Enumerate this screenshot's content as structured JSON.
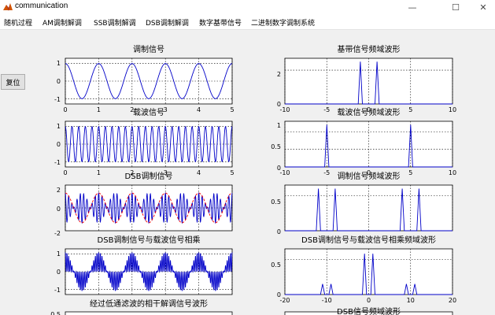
{
  "window": {
    "title": "communication",
    "minimize_glyph": "—",
    "maximize_glyph": "☐",
    "close_glyph": "✕"
  },
  "menu": [
    "随机过程",
    "AM调制解调",
    "SSB调制解调",
    "DSB调制解调",
    "数字基带信号",
    "二进制数字调制系统"
  ],
  "reset_button": "复位",
  "chart_data": [
    {
      "type": "line",
      "title": "调制信号",
      "xlim": [
        0,
        5
      ],
      "ylim": [
        -1.3,
        1.3
      ],
      "xticks": [
        "0",
        "1",
        "2",
        "3",
        "4",
        "5"
      ],
      "yticks": [
        "1",
        "0",
        "-1"
      ],
      "series": [
        {
          "function": "cos",
          "frequency": 1,
          "amplitude": 1,
          "color": "#0000c8"
        }
      ]
    },
    {
      "type": "line",
      "title": "载波信号",
      "xlim": [
        0,
        5
      ],
      "ylim": [
        -1.3,
        1.3
      ],
      "xticks": [
        "0",
        "1",
        "2",
        "3",
        "4",
        "5"
      ],
      "yticks": [
        "1",
        "0",
        "-1"
      ],
      "series": [
        {
          "function": "cos",
          "frequency": 5,
          "amplitude": 1,
          "color": "#0000c8"
        }
      ]
    },
    {
      "type": "line",
      "title": "DSB调制信号",
      "xlim": [
        0,
        5
      ],
      "ylim": [
        -2,
        2
      ],
      "xticks": [],
      "yticks": [
        "2",
        "0",
        "-2"
      ],
      "series": [
        {
          "function": "dsb",
          "color": "#0000c8"
        },
        {
          "function": "envelope",
          "amplitude": 1.3,
          "frequency": 1,
          "color": "#ff0000",
          "dashed": true
        }
      ]
    },
    {
      "type": "line",
      "title": "DSB调制信号与载波信号相乘",
      "xlim": [
        0,
        5
      ],
      "ylim": [
        -1.3,
        1.3
      ],
      "xticks": [],
      "yticks": [
        "1",
        "0",
        "-1"
      ],
      "series": [
        {
          "function": "product",
          "color": "#0000c8"
        }
      ]
    },
    {
      "type": "line",
      "title": "基带信号频域波形",
      "xlim": [
        -10,
        10
      ],
      "ylim": [
        0,
        2.7
      ],
      "xticks": [
        "-10",
        "-5",
        "0",
        "5",
        "10"
      ],
      "yticks": [
        "2",
        "0"
      ],
      "series": [
        {
          "peaks": [
            {
              "x": -1,
              "y": 2.5
            },
            {
              "x": 1,
              "y": 2.5
            }
          ],
          "color": "#0000c8"
        }
      ]
    },
    {
      "type": "line",
      "title": "载波信号频域波形",
      "xlim": [
        -10,
        10
      ],
      "ylim": [
        0,
        1.3
      ],
      "xticks": [
        "-10",
        "-5",
        "0",
        "5",
        "10"
      ],
      "yticks": [
        "1",
        "0.5",
        "0"
      ],
      "series": [
        {
          "peaks": [
            {
              "x": -5,
              "y": 1.2
            },
            {
              "x": 5,
              "y": 1.2
            }
          ],
          "color": "#0000c8"
        }
      ]
    },
    {
      "type": "line",
      "title": "调制信号频域波形",
      "xlim": [
        -10,
        10
      ],
      "ylim": [
        0,
        0.65
      ],
      "xticks": [
        "-10",
        "-5",
        "0",
        "5",
        "10"
      ],
      "yticks": [
        "0.5",
        "0"
      ],
      "series": [
        {
          "peaks": [
            {
              "x": -6,
              "y": 0.6
            },
            {
              "x": -4,
              "y": 0.6
            },
            {
              "x": 4,
              "y": 0.6
            },
            {
              "x": 6,
              "y": 0.6
            }
          ],
          "color": "#0000c8"
        }
      ]
    },
    {
      "type": "line",
      "title": "DSB调制信号与载波信号相乘频域波形",
      "xlim": [
        -20,
        20
      ],
      "ylim": [
        0,
        0.65
      ],
      "xticks": [
        "-20",
        "-10",
        "0",
        "10",
        "20"
      ],
      "yticks": [
        "0.5",
        "0"
      ],
      "series": [
        {
          "peaks": [
            {
              "x": -11,
              "y": 0.15
            },
            {
              "x": -9,
              "y": 0.15
            },
            {
              "x": -1,
              "y": 0.58
            },
            {
              "x": 1,
              "y": 0.58
            },
            {
              "x": 9,
              "y": 0.15
            },
            {
              "x": 11,
              "y": 0.15
            }
          ],
          "color": "#0000c8"
        }
      ]
    },
    {
      "type": "line",
      "title": "经过低通滤波的相干解调信号波形",
      "yticks": [
        "0.5"
      ],
      "series": []
    },
    {
      "type": "line",
      "title": "DSB信号频域波形",
      "series": []
    }
  ]
}
